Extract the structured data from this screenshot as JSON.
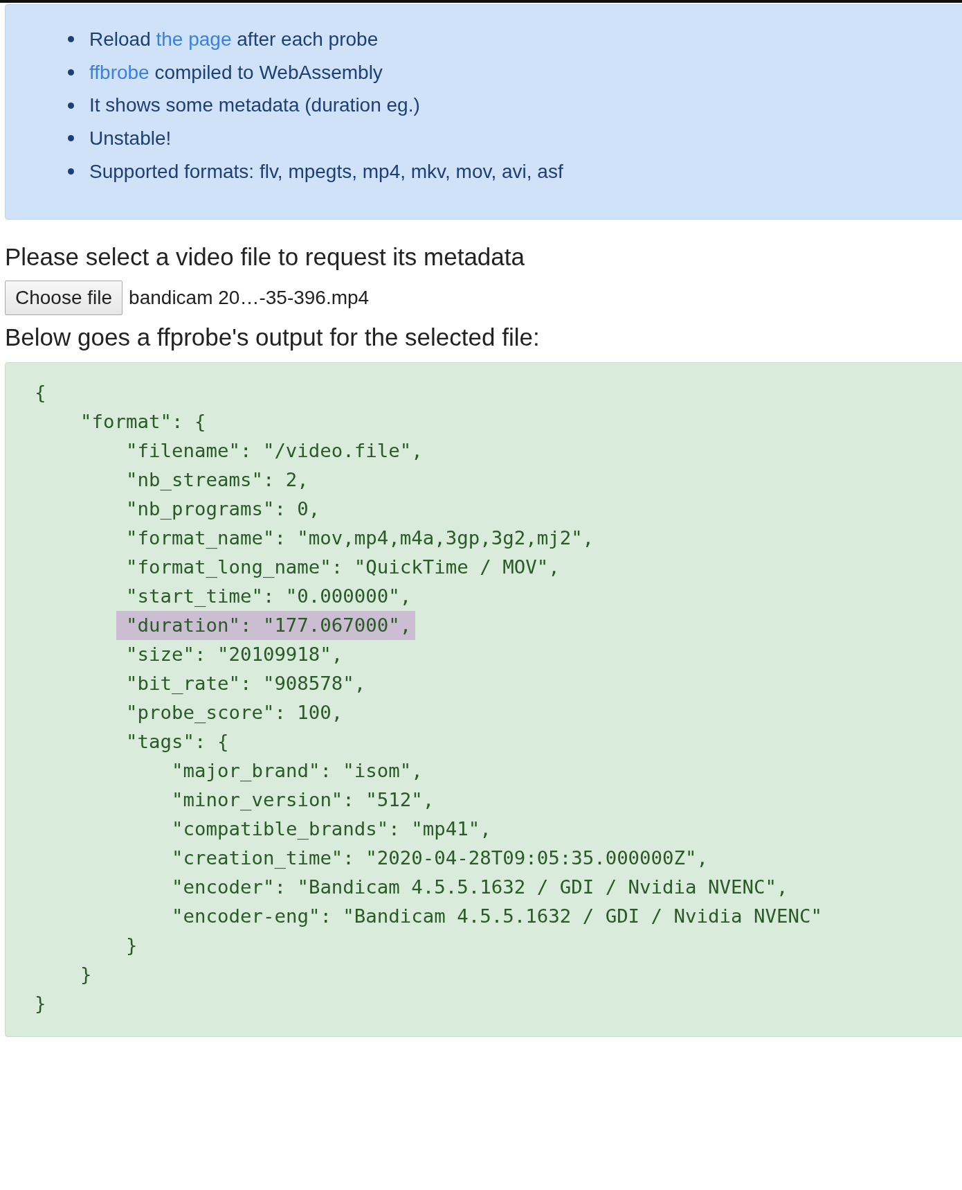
{
  "info_box": {
    "items": [
      [
        {
          "text": "Reload "
        },
        {
          "text": "the page",
          "kind": "link"
        },
        {
          "text": " after each probe"
        }
      ],
      [
        {
          "text": "ffbrobe",
          "kind": "link"
        },
        {
          "text": " compiled to WebAssembly"
        }
      ],
      [
        {
          "text": "It shows some metadata (duration eg.)"
        }
      ],
      [
        {
          "text": "Unstable!"
        }
      ],
      [
        {
          "text": "Supported formats: flv, mpegts, mp4, mkv, mov, avi, asf"
        }
      ]
    ]
  },
  "select_heading": "Please select a video file to request its metadata",
  "file_input": {
    "button": "Choose file",
    "file_name": "bandicam 20…-35-396.mp4"
  },
  "output_heading": "Below goes a ffprobe's output for the selected file:",
  "output": {
    "line": "{",
    "highlighted": false,
    "close": "}",
    "children": [
      {
        "line": "\"format\": {",
        "highlighted": false,
        "close": "}",
        "children": [
          {
            "line": "\"filename\": \"/video.file\",",
            "highlighted": false
          },
          {
            "line": "\"nb_streams\": 2,",
            "highlighted": false
          },
          {
            "line": "\"nb_programs\": 0,",
            "highlighted": false
          },
          {
            "line": "\"format_name\": \"mov,mp4,m4a,3gp,3g2,mj2\",",
            "highlighted": false
          },
          {
            "line": "\"format_long_name\": \"QuickTime / MOV\",",
            "highlighted": false
          },
          {
            "line": "\"start_time\": \"0.000000\",",
            "highlighted": false
          },
          {
            "line": "\"duration\": \"177.067000\",",
            "highlighted": true
          },
          {
            "line": "\"size\": \"20109918\",",
            "highlighted": false
          },
          {
            "line": "\"bit_rate\": \"908578\",",
            "highlighted": false
          },
          {
            "line": "\"probe_score\": 100,",
            "highlighted": false
          },
          {
            "line": "\"tags\": {",
            "highlighted": false,
            "close": "}",
            "children": [
              {
                "line": "\"major_brand\": \"isom\",",
                "highlighted": false
              },
              {
                "line": "\"minor_version\": \"512\",",
                "highlighted": false
              },
              {
                "line": "\"compatible_brands\": \"mp41\",",
                "highlighted": false
              },
              {
                "line": "\"creation_time\": \"2020-04-28T09:05:35.000000Z\",",
                "highlighted": false
              },
              {
                "line": "\"encoder\": \"Bandicam 4.5.5.1632 / GDI / Nvidia NVENC\",",
                "highlighted": false
              },
              {
                "line": "\"encoder-eng\": \"Bandicam 4.5.5.1632 / GDI / Nvidia NVENC\"",
                "highlighted": false
              }
            ]
          }
        ]
      }
    ]
  }
}
